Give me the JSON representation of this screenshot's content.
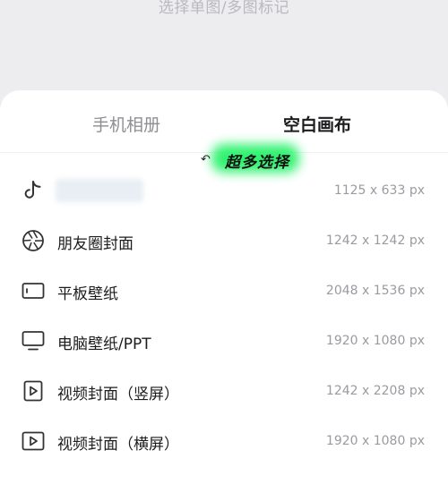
{
  "header": {
    "hint": "选择单图/多图标记"
  },
  "tabs": [
    {
      "label": "手机相册",
      "active": false
    },
    {
      "label": "空白画布",
      "active": true
    }
  ],
  "promo": {
    "label": "超多选择",
    "color": "#27f26a"
  },
  "options": [
    {
      "icon": "tiktok-icon",
      "label": "",
      "size": "1125 x 633 px"
    },
    {
      "icon": "aperture-icon",
      "label": "朋友圈封面",
      "size": "1242 x 1242 px"
    },
    {
      "icon": "tablet-icon",
      "label": "平板壁纸",
      "size": "2048 x 1536 px"
    },
    {
      "icon": "monitor-icon",
      "label": "电脑壁纸/PPT",
      "size": "1920 x 1080 px"
    },
    {
      "icon": "video-icon",
      "label": "视频封面（竖屏）",
      "size": "1242 x 2208 px"
    },
    {
      "icon": "video-icon",
      "label": "视频封面（横屏）",
      "size": "1920 x 1080 px"
    }
  ]
}
